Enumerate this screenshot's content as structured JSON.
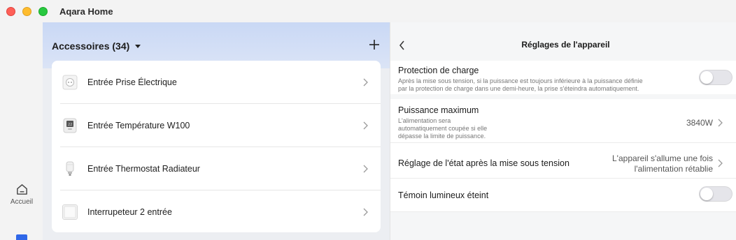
{
  "window": {
    "title": "Aqara Home",
    "controls": [
      "close",
      "minimize",
      "maximize"
    ]
  },
  "rail": {
    "home": {
      "label": "Accueil",
      "icon": "home-icon"
    }
  },
  "accessories": {
    "title": "Accessoires (34)",
    "add_icon": "plus-icon",
    "items": [
      {
        "label": "Entrée Prise Électrique",
        "icon": "wall-socket-icon"
      },
      {
        "label": "Entrée Température W100",
        "icon": "temperature-sensor-icon"
      },
      {
        "label": "Entrée Thermostat Radiateur",
        "icon": "radiator-thermostat-icon"
      },
      {
        "label": "Interrupeteur 2 entrée",
        "icon": "wall-switch-icon"
      }
    ]
  },
  "settings": {
    "title": "Réglages de l'appareil",
    "back_icon": "chevron-left-icon",
    "load_protection": {
      "title": "Protection de charge",
      "desc_line1": "Après la mise sous tension, si la puissance est toujours inférieure à la puissance définie",
      "desc_line2": "par la protection de charge dans une demi-heure, la prise s'éteindra automatiquement.",
      "enabled": false
    },
    "max_power": {
      "title": "Puissance maximum",
      "desc_line1": "L'alimentation sera",
      "desc_line2": "automatiquement coupée si elle",
      "desc_line3": "dépasse la limite de puissance.",
      "value": "3840W"
    },
    "power_on_state": {
      "title": "Réglage de l'état après la mise sous tension",
      "value_line1": "L'appareil s'allume une fois",
      "value_line2": "l'alimentation rétablie"
    },
    "indicator_light": {
      "title": "Témoin lumineux éteint",
      "enabled": false
    }
  }
}
